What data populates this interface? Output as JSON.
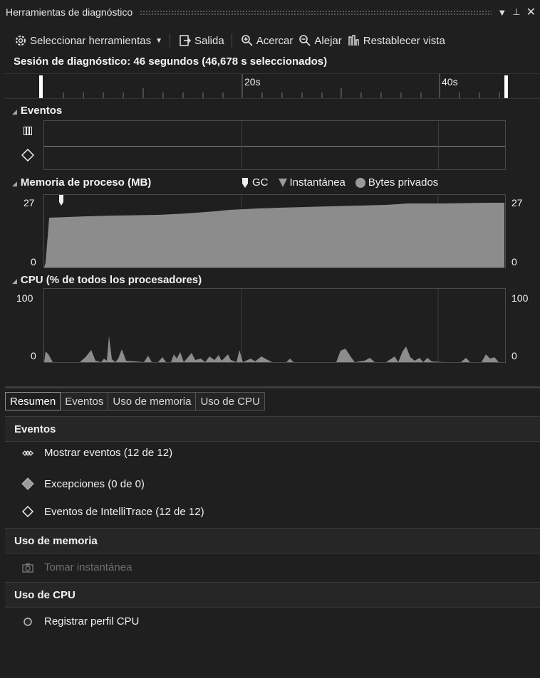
{
  "window": {
    "title": "Herramientas de diagnóstico",
    "dropdown_icon": "caret-down-icon",
    "pin_icon": "pin-icon",
    "close_icon": "close-icon"
  },
  "toolbar": {
    "select_tools": "Seleccionar herramientas",
    "output": "Salida",
    "zoom_in": "Acercar",
    "zoom_out": "Alejar",
    "reset_view": "Restablecer vista"
  },
  "session": {
    "text": "Sesión de diagnóstico: 46 segundos (46,678 s seleccionados)",
    "ruler_labels": [
      "20s",
      "40s"
    ]
  },
  "events_panel": {
    "title": "Eventos"
  },
  "memory_panel": {
    "title": "Memoria de proceso (MB)",
    "legend": {
      "gc": "GC",
      "snapshot": "Instantánea",
      "private_bytes": "Bytes privados"
    },
    "y_max": "27",
    "y_min": "0"
  },
  "cpu_panel": {
    "title": "CPU (% de todos los procesadores)",
    "y_max": "100",
    "y_min": "0"
  },
  "tabs": [
    "Resumen",
    "Eventos",
    "Uso de memoria",
    "Uso de CPU"
  ],
  "summary": {
    "events_header": "Eventos",
    "show_events": "Mostrar eventos (12 de 12)",
    "exceptions": "Excepciones (0 de 0)",
    "intellitrace": "Eventos de IntelliTrace (12 de 12)",
    "memory_header": "Uso de memoria",
    "take_snapshot": "Tomar instantánea",
    "cpu_header": "Uso de CPU",
    "record_cpu": "Registrar perfil CPU"
  },
  "colors": {
    "background": "#1f1f1f",
    "chart_fill": "#8c8c8c",
    "selection_marker": "#ffffff"
  }
}
